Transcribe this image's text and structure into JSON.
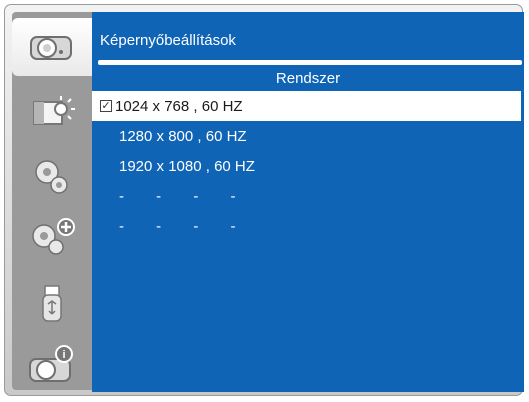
{
  "header": {
    "title": "Képernyőbeállítások",
    "section": "Rendszer"
  },
  "sidebar": {
    "items": [
      {
        "icon": "projector-icon",
        "active": true
      },
      {
        "icon": "brightness-icon",
        "active": false
      },
      {
        "icon": "gear-icon",
        "active": false
      },
      {
        "icon": "gear-plus-icon",
        "active": false
      },
      {
        "icon": "usb-icon",
        "active": false
      },
      {
        "icon": "projector-info-icon",
        "active": false
      }
    ]
  },
  "resolutions": {
    "items": [
      {
        "label": "1024 x 768 , 60 HZ",
        "checked": true
      },
      {
        "label": "1280 x 800 , 60 HZ",
        "checked": false
      },
      {
        "label": "1920 x 1080 , 60 HZ",
        "checked": false
      },
      {
        "label": "- - - -",
        "checked": false
      },
      {
        "label": "- - - -",
        "checked": false
      }
    ]
  },
  "check_mark": "✓",
  "colors": {
    "panel_blue": "#0f64b6",
    "sidebar_gray": "#9a9a9a",
    "selection": "#ffffff"
  }
}
